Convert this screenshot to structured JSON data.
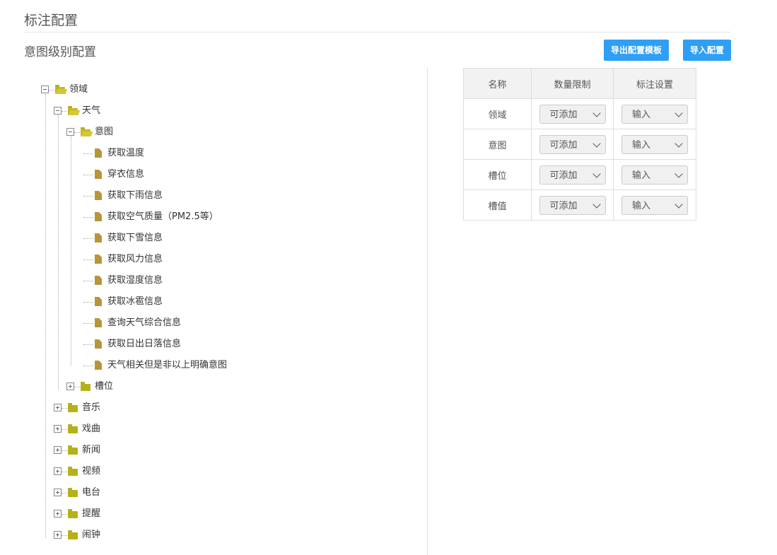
{
  "header": {
    "title": "标注配置"
  },
  "section": {
    "title": "意图级别配置"
  },
  "buttons": {
    "export_label": "导出配置模板",
    "import_label": "导入配置"
  },
  "tree": {
    "root": "领域",
    "weather": "天气",
    "intent": "意图",
    "intents": [
      "获取温度",
      "穿衣信息",
      "获取下雨信息",
      "获取空气质量（PM2.5等）",
      "获取下雪信息",
      "获取风力信息",
      "获取湿度信息",
      "获取冰雹信息",
      "查询天气综合信息",
      "获取日出日落信息",
      "天气相关但是非以上明确意图"
    ],
    "slot": "槽位",
    "domains": [
      "音乐",
      "戏曲",
      "新闻",
      "视频",
      "电台",
      "提醒",
      "闹钟"
    ]
  },
  "table": {
    "headers": [
      "名称",
      "数量限制",
      "标注设置"
    ],
    "rows": [
      {
        "name": "领域",
        "limit": "可添加",
        "setting": "输入"
      },
      {
        "name": "意图",
        "limit": "可添加",
        "setting": "输入"
      },
      {
        "name": "槽位",
        "limit": "可添加",
        "setting": "输入"
      },
      {
        "name": "槽值",
        "limit": "可添加",
        "setting": "输入"
      }
    ]
  },
  "colors": {
    "accent": "#2e9ff5",
    "folder": "#b5b11a",
    "file": "#b8953a"
  }
}
